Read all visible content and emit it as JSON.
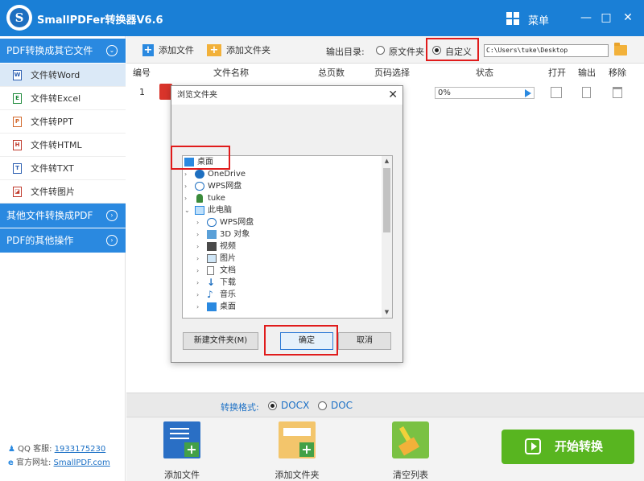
{
  "app": {
    "title": "SmallPDFer转换器V6.6",
    "logo_letter": "S",
    "menu_label": "菜单"
  },
  "window_controls": {
    "minimize": "—",
    "maximize": "□",
    "close": "✕"
  },
  "sidebar": {
    "section1": "PDF转换成其它文件",
    "items": [
      {
        "label": "文件转Word",
        "icon": "W",
        "active": true
      },
      {
        "label": "文件转Excel",
        "icon": "E"
      },
      {
        "label": "文件转PPT",
        "icon": "P"
      },
      {
        "label": "文件转HTML",
        "icon": "H"
      },
      {
        "label": "文件转TXT",
        "icon": "T"
      },
      {
        "label": "文件转图片",
        "icon": "◪"
      }
    ],
    "section2": "其他文件转换成PDF",
    "section3": "PDF的其他操作",
    "contact": {
      "qq_label": "QQ 客服:",
      "qq_value": "1933175230",
      "site_label": "官方网址:",
      "site_value": "SmallPDF.com"
    }
  },
  "toolbar": {
    "add_file": "添加文件",
    "add_folder": "添加文件夹",
    "output_label": "输出目录:",
    "opt_original": "原文件夹",
    "opt_custom": "自定义",
    "selected": "custom",
    "path": "C:\\Users\\tuke\\Desktop"
  },
  "table": {
    "headers": [
      "编号",
      "文件名称",
      "总页数",
      "页码选择",
      "状态",
      "打开",
      "输出",
      "移除"
    ],
    "rows": [
      {
        "index": "1",
        "progress": "0%"
      }
    ]
  },
  "format": {
    "label": "转换格式:",
    "opt1": "DOCX",
    "opt2": "DOC",
    "selected": "DOCX"
  },
  "bottom": {
    "add_file": "添加文件",
    "add_folder": "添加文件夹",
    "clear": "清空列表",
    "start": "开始转换"
  },
  "dialog": {
    "title": "浏览文件夹",
    "close": "✕",
    "tree": [
      {
        "label": "桌面",
        "icon": "desktop-icon",
        "level": 0,
        "selected": true
      },
      {
        "label": "OneDrive",
        "icon": "cloud-icon",
        "level": 1
      },
      {
        "label": "WPS网盘",
        "icon": "cloud-outline-icon",
        "level": 1
      },
      {
        "label": "tuke",
        "icon": "user-icon",
        "level": 1
      },
      {
        "label": "此电脑",
        "icon": "computer-icon",
        "level": 1,
        "expanded": true
      },
      {
        "label": "WPS网盘",
        "icon": "cloud-outline-icon",
        "level": 2
      },
      {
        "label": "3D 对象",
        "icon": "cube-icon",
        "level": 2
      },
      {
        "label": "视频",
        "icon": "video-icon",
        "level": 2
      },
      {
        "label": "图片",
        "icon": "picture-icon",
        "level": 2
      },
      {
        "label": "文档",
        "icon": "document-icon",
        "level": 2
      },
      {
        "label": "下载",
        "icon": "download-icon",
        "level": 2
      },
      {
        "label": "音乐",
        "icon": "music-icon",
        "level": 2
      },
      {
        "label": "桌面",
        "icon": "desktop-icon",
        "level": 2
      }
    ],
    "new_folder": "新建文件夹(M)",
    "ok": "确定",
    "cancel": "取消"
  },
  "colors": {
    "accent": "#1a7fd6",
    "start": "#58b520",
    "highlight": "#e01b1b"
  }
}
